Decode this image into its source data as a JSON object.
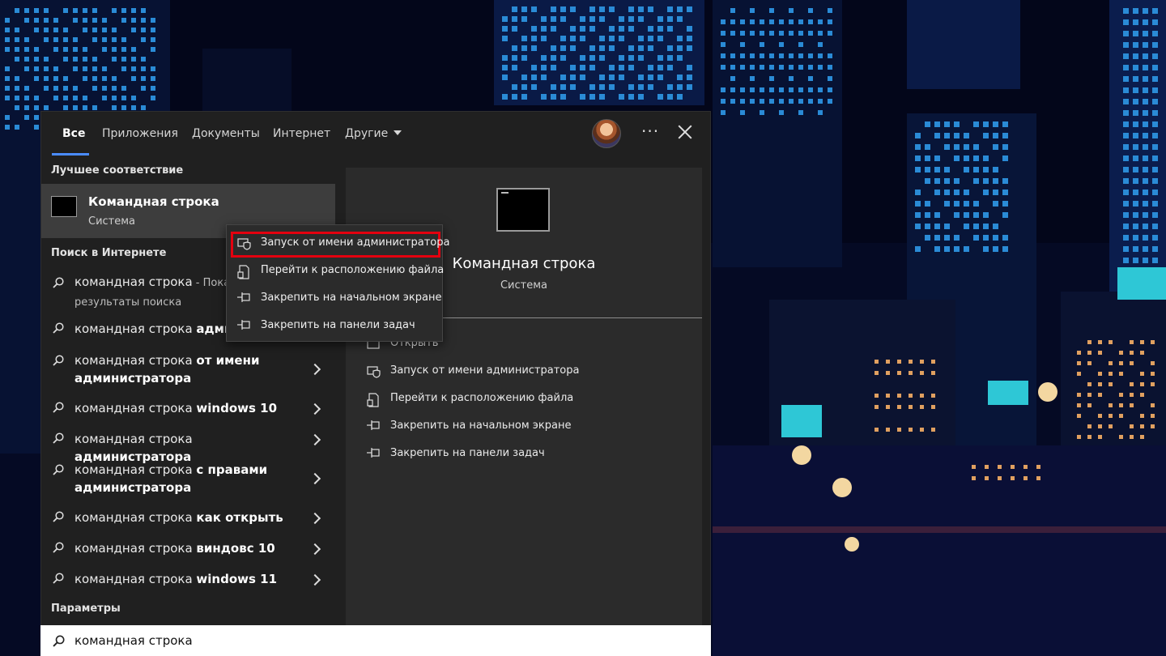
{
  "tabs": [
    {
      "label": "Все"
    },
    {
      "label": "Приложения"
    },
    {
      "label": "Документы"
    },
    {
      "label": "Интернет"
    },
    {
      "label": "Другие"
    }
  ],
  "more_label": "···",
  "best_match": {
    "heading": "Лучшее соответствие",
    "title": "Командная строка",
    "subtitle": "Система"
  },
  "web": {
    "heading": "Поиск в Интернете",
    "results": [
      {
        "normal": "командная строка",
        "bold": "",
        "suffix": " - Показа",
        "line2": "результаты поиска"
      },
      {
        "normal": "командная строка ",
        "bold": "админ",
        "suffix": "",
        "line2": ""
      },
      {
        "normal": "командная строка ",
        "bold": "от имени администратора",
        "suffix": "",
        "line2": ""
      },
      {
        "normal": "командная строка ",
        "bold": "windows 10",
        "suffix": "",
        "line2": ""
      },
      {
        "normal": "командная строка ",
        "bold": "администратора",
        "suffix": "",
        "line2": ""
      },
      {
        "normal": "командная строка ",
        "bold": "с правами администратора",
        "suffix": "",
        "line2": ""
      },
      {
        "normal": "командная строка ",
        "bold": "как открыть",
        "suffix": "",
        "line2": ""
      },
      {
        "normal": "командная строка ",
        "bold": "виндовс 10",
        "suffix": "",
        "line2": ""
      },
      {
        "normal": "командная строка ",
        "bold": "windows 11",
        "suffix": "",
        "line2": ""
      }
    ]
  },
  "settings_heading": "Параметры",
  "preview": {
    "title": "Командная строка",
    "subtitle": "Система",
    "actions": [
      {
        "label": "Открыть",
        "icon": "open-icon"
      },
      {
        "label": "Запуск от имени администратора",
        "icon": "shield-icon"
      },
      {
        "label": "Перейти к расположению файла",
        "icon": "file-location-icon"
      },
      {
        "label": "Закрепить на начальном экране",
        "icon": "pin-icon"
      },
      {
        "label": "Закрепить на панели задач",
        "icon": "pin-icon"
      }
    ]
  },
  "context_menu": {
    "items": [
      {
        "label": "Запуск от имени администратора",
        "icon": "shield-icon"
      },
      {
        "label": "Перейти к расположению файла",
        "icon": "file-location-icon"
      },
      {
        "label": "Закрепить на начальном экране",
        "icon": "pin-icon"
      },
      {
        "label": "Закрепить на панели задач",
        "icon": "pin-icon"
      }
    ],
    "highlight_color": "#e3000f"
  },
  "search": {
    "query": "командная строка"
  },
  "colors": {
    "accent": "#4a8cff",
    "panel": "#202020",
    "selected": "#3d3d3d"
  }
}
